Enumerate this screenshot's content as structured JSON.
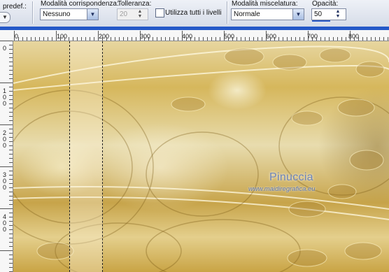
{
  "toolbar": {
    "preset_label": "predef.:",
    "match_mode": {
      "label": "Modalità corrispondenza:",
      "value": "Nessuno"
    },
    "tolerance": {
      "label": "Tolleranza:",
      "value": "20"
    },
    "sample_merged": {
      "label": "Utilizza tutti i livelli",
      "checked": false
    },
    "blend_mode": {
      "label": "Modalità miscelatura:",
      "value": "Normale"
    },
    "opacity": {
      "label": "Opacità:",
      "value": "50"
    }
  },
  "ruler": {
    "h_labels": [
      "0",
      "100",
      "200",
      "300",
      "400",
      "500",
      "600",
      "700",
      "800"
    ],
    "v_labels": [
      "0",
      "100",
      "200",
      "300",
      "400"
    ]
  },
  "watermark": {
    "name": "Pinuccia",
    "site": "www.maidiregrafica.eu"
  },
  "colors": {
    "ruler_accent": "#2458c8",
    "selection": "#222222"
  }
}
